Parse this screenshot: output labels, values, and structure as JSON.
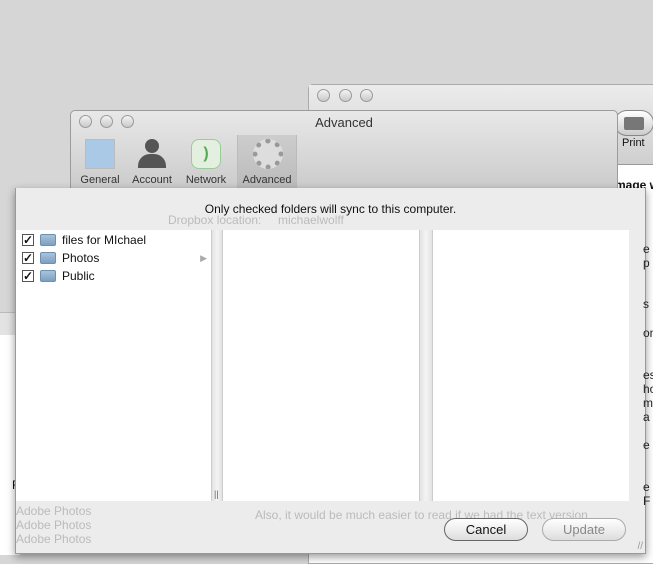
{
  "back_window": {
    "toolbar": {
      "partial_label": "d",
      "print_label": "Print"
    },
    "heading_fragment": "of image w",
    "text_fragments": [
      "e",
      "p",
      "s",
      "on",
      "es",
      "ho",
      "m",
      "a",
      "e",
      "e F"
    ],
    "faded_text": "Also, it would be much easier to read if we had the text version",
    "sidebar_faded": [
      "Adobe Photos",
      "Adobe Photos",
      "Adobe Photos"
    ],
    "left_fragment": "F"
  },
  "prefs_window": {
    "title": "Advanced",
    "tabs": [
      {
        "label": "General",
        "icon": "dropbox-general-icon"
      },
      {
        "label": "Account",
        "icon": "person-icon"
      },
      {
        "label": "Network",
        "icon": "network-icon"
      },
      {
        "label": "Advanced",
        "icon": "gear-icon",
        "selected": true
      }
    ],
    "faded_setting": {
      "label": "Dropbox location:",
      "value": "michaelwolff"
    }
  },
  "sheet": {
    "message": "Only checked folders will sync to this computer.",
    "folders": [
      {
        "name": "files for MIchael",
        "checked": true,
        "has_children": false
      },
      {
        "name": "Photos",
        "checked": true,
        "has_children": true
      },
      {
        "name": "Public",
        "checked": true,
        "has_children": false
      }
    ],
    "cancel_label": "Cancel",
    "update_label": "Update",
    "update_enabled": false
  }
}
